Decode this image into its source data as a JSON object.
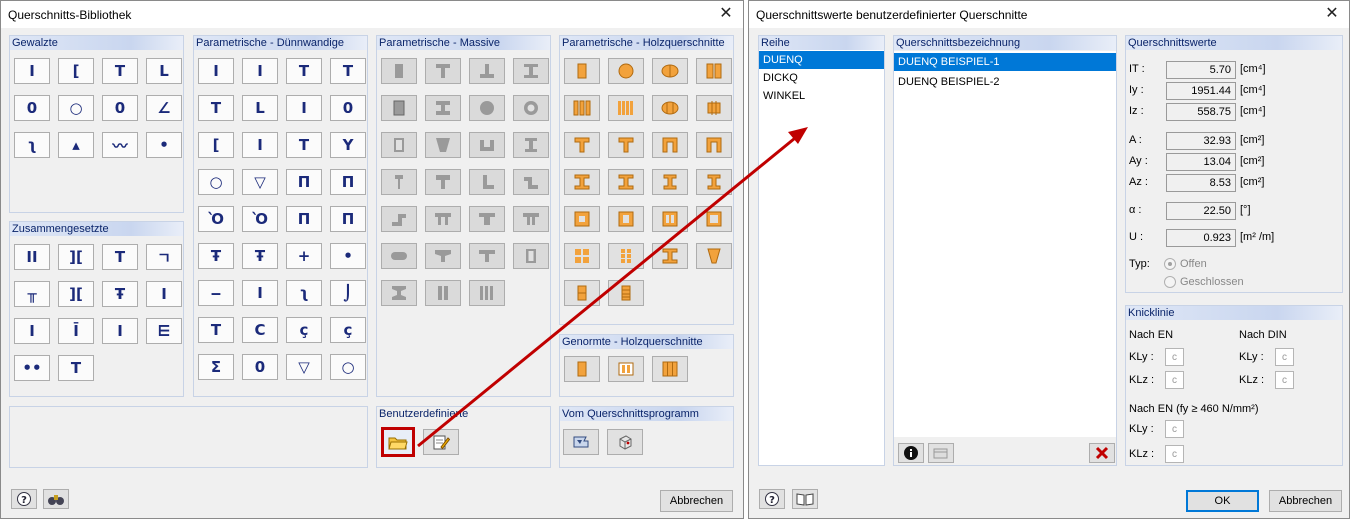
{
  "left_dialog": {
    "title": "Querschnitts-Bibliothek",
    "groups": {
      "gewalzte": {
        "title": "Gewalzte",
        "tiles": [
          "I",
          "[",
          "T",
          "L",
          "0",
          "○",
          "0",
          "∠",
          "ʅ",
          "▴",
          "〰",
          "•"
        ]
      },
      "zusammengesetzte": {
        "title": "Zusammengesetzte",
        "tiles": [
          "II",
          "][",
          "T",
          "ㄱ",
          "╥",
          "][",
          "Ŧ",
          "I",
          "I",
          "Ī",
          "I",
          "⋿",
          "••",
          "T"
        ]
      },
      "duennwandige": {
        "title": "Parametrische - Dünnwandige",
        "tiles": [
          "I",
          "I",
          "T",
          "T",
          "T",
          "L",
          "I",
          "0",
          "[",
          "I",
          "T",
          "Y",
          "○",
          "▽",
          "Π",
          "Π",
          "Ὸ",
          "Ὸ",
          "Π",
          "Π",
          "Ŧ",
          "Ŧ",
          "+",
          "•",
          "‒",
          "I",
          "ʅ",
          "⌡",
          "T",
          "C",
          "ç",
          "ç",
          "Σ",
          "0",
          "▽",
          "○"
        ]
      },
      "massive": {
        "title": "Parametrische - Massive"
      },
      "holz": {
        "title": "Parametrische - Holzquerschnitte"
      },
      "genormte": {
        "title": "Genormte - Holzquerschnitte"
      },
      "benutzerdefinierte": {
        "title": "Benutzerdefinierte"
      },
      "programm": {
        "title": "Vom Querschnittsprogramm"
      }
    },
    "cancel_label": "Abbrechen"
  },
  "right_dialog": {
    "title": "Querschnittswerte benutzerdefinierter Querschnitte",
    "reihe": {
      "title": "Reihe",
      "items": [
        "DUENQ",
        "DICKQ",
        "WINKEL"
      ]
    },
    "bezeichnung": {
      "title": "Querschnittsbezeichnung",
      "items": [
        "DUENQ BEISPIEL-1",
        "DUENQ BEISPIEL-2"
      ]
    },
    "werte": {
      "title": "Querschnittswerte",
      "rows": [
        {
          "label": "IT :",
          "value": "5.70",
          "unit": "[cm⁴]"
        },
        {
          "label": "Iy :",
          "value": "1951.44",
          "unit": "[cm⁴]"
        },
        {
          "label": "Iz :",
          "value": "558.75",
          "unit": "[cm⁴]"
        },
        {
          "label": "A :",
          "value": "32.93",
          "unit": "[cm²]"
        },
        {
          "label": "Ay :",
          "value": "13.04",
          "unit": "[cm²]"
        },
        {
          "label": "Az :",
          "value": "8.53",
          "unit": "[cm²]"
        },
        {
          "label": "α :",
          "value": "22.50",
          "unit": "[°]"
        },
        {
          "label": "U :",
          "value": "0.923",
          "unit": "[m² /m]"
        }
      ],
      "typ_label": "Typ:",
      "typ_options": [
        "Offen",
        "Geschlossen"
      ]
    },
    "knicklinie": {
      "title": "Knicklinie",
      "nach_en": "Nach EN",
      "nach_din": "Nach DIN",
      "kly": "KLy :",
      "klz": "KLz :",
      "value": "c",
      "nach_en_460": "Nach EN (fy ≥ 460 N/mm²)"
    },
    "ok_label": "OK",
    "cancel_label": "Abbrechen"
  },
  "colors": {
    "accent": "#0078d7",
    "highlight": "#c00000",
    "wood": "#f2a23c"
  }
}
